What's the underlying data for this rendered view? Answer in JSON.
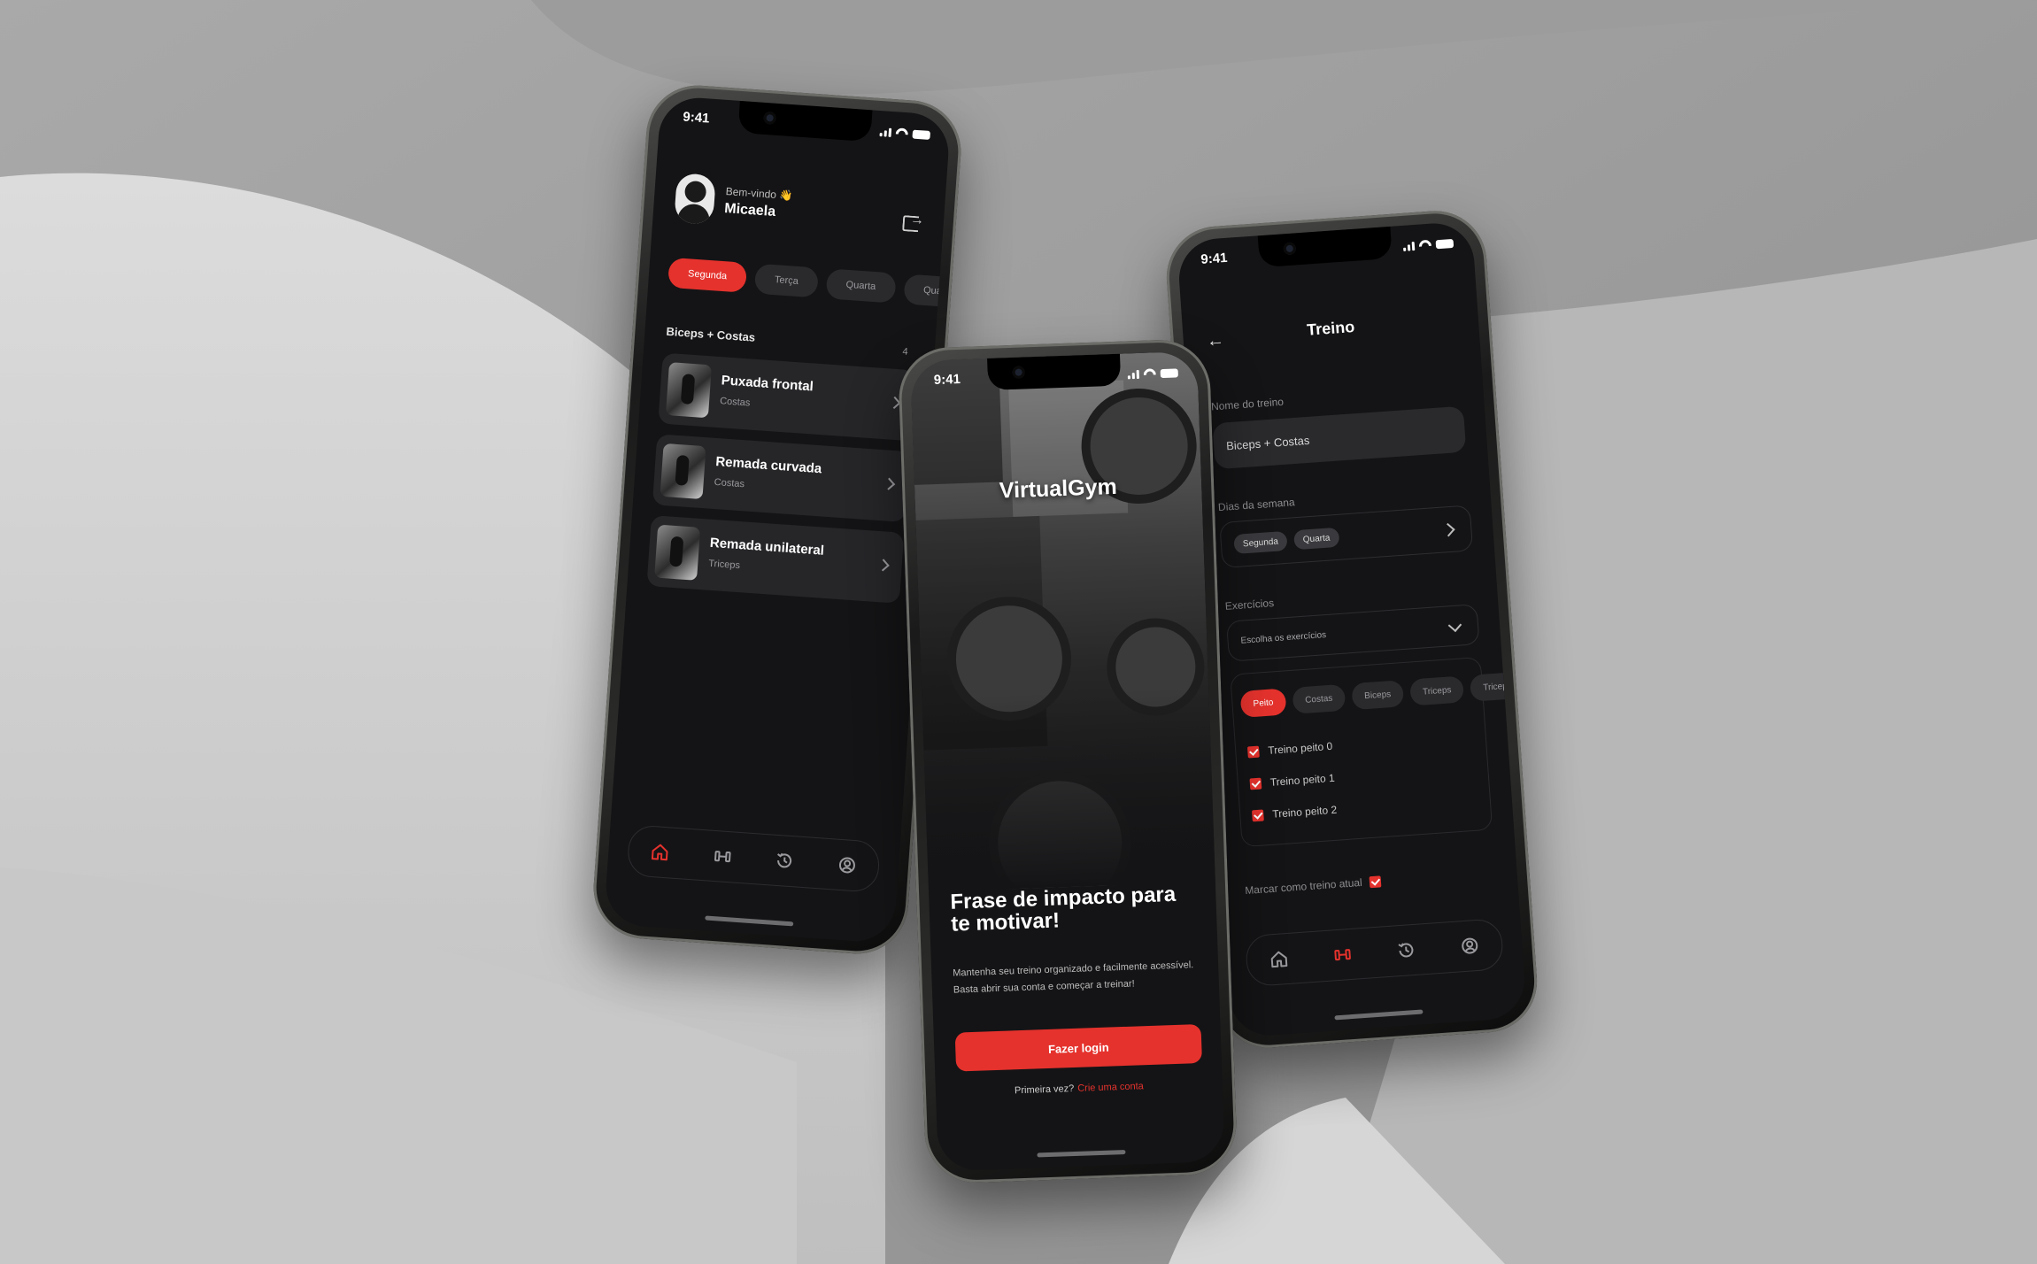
{
  "colors": {
    "accent": "#e5322d",
    "screen_bg": "#141416",
    "card_bg": "#262629",
    "backdrop": "#bdbdbd"
  },
  "status_bar": {
    "time": "9:41"
  },
  "home": {
    "greeting": "Bem-vindo 👋",
    "user_name": "Micaela",
    "days": [
      "Segunda",
      "Terça",
      "Quarta",
      "Quarta"
    ],
    "selected_day": "Segunda",
    "workout_title": "Biceps + Costas",
    "exercise_count": "4",
    "exercises": [
      {
        "name": "Puxada frontal",
        "group": "Costas"
      },
      {
        "name": "Remada curvada",
        "group": "Costas"
      },
      {
        "name": "Remada unilateral",
        "group": "Triceps"
      }
    ],
    "nav_icons": [
      "home-icon",
      "dumbbell-icon",
      "history-icon",
      "profile-icon"
    ],
    "active_tab": "home"
  },
  "login": {
    "app_name": "VirtualGym",
    "headline": "Frase de impacto para te motivar!",
    "description": "Mantenha seu treino organizado e facilmente acessível. Basta abrir sua conta e começar a treinar!",
    "login_button": "Fazer login",
    "signup_prompt": "Primeira vez?",
    "signup_link": "Crie uma conta"
  },
  "treino": {
    "title": "Treino",
    "name_label": "Nome do treino",
    "name_value": "Biceps + Costas",
    "days_label": "Dias da semana",
    "selected_days": [
      "Segunda",
      "Quarta"
    ],
    "exercises_label": "Exercícios",
    "exercises_placeholder": "Escolha os exercícios",
    "muscle_groups": [
      "Peito",
      "Costas",
      "Biceps",
      "Triceps",
      "Triceps"
    ],
    "selected_group": "Peito",
    "checked_items": [
      "Treino peito 0",
      "Treino peito 1",
      "Treino peito 2"
    ],
    "current_label": "Marcar como treino atual",
    "active_tab": "dumbbell"
  }
}
